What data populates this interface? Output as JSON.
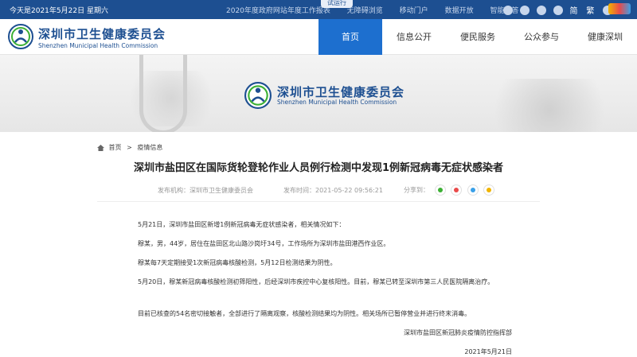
{
  "topbar": {
    "date": "今天是2021年5月22日 星期六",
    "links": [
      "2020年度政府网站年度工作报表",
      "无障碍浏览",
      "移动门户",
      "数据开放",
      "智能问答"
    ],
    "trial_badge": "试运行",
    "lang_simplified": "简",
    "lang_traditional": "繁",
    "icons": [
      "microphone-icon",
      "weibo-icon",
      "wechat-icon",
      "person-icon"
    ]
  },
  "header": {
    "site_name": "深圳市卫生健康委员会",
    "site_name_en": "Shenzhen Municipal Health Commission",
    "nav": [
      "首页",
      "信息公开",
      "便民服务",
      "公众参与",
      "健康深圳"
    ],
    "active_nav": "首页"
  },
  "banner": {
    "site_name": "深圳市卫生健康委员会",
    "site_name_en": "Shenzhen Municipal Health Commission"
  },
  "breadcrumb": {
    "home": "首页",
    "current": "疫情信息"
  },
  "article": {
    "title": "深圳市盐田区在国际货轮登轮作业人员例行检测中发现1例新冠病毒无症状感染者",
    "publisher": "发布机构：深圳市卫生健康委员会",
    "publish_time": "发布时间：2021-05-22 09:56:21",
    "share_label": "分享到：",
    "share_colors": [
      "#3cb034",
      "#e94a4a",
      "#3aa0e8",
      "#f0b400"
    ],
    "paragraphs": [
      "5月21日，深圳市盐田区新增1例新冠病毒无症状感染者，相关情况如下：",
      "穆某，男，44岁，居住在盐田区北山路沙岗圩34号，工作场所为深圳市盐田港西作业区。",
      "穆某每7天定期接受1次新冠病毒核酸检测，5月12日检测结果为阴性。",
      "5月20日，穆某新冠病毒核酸检测初筛阳性，后经深圳市疾控中心复核阳性。目前，穆某已转至深圳市第三人民医院隔离治疗。",
      "目前已核查的54名密切接触者，全部进行了隔离观察，核酸检测结果均为阴性。相关场所已暂停营业并进行终末消毒。"
    ],
    "signature": "深圳市盐田区新冠肺炎疫情防控指挥部",
    "date": "2021年5月21日"
  },
  "colors": {
    "topbar": "#1d4f91",
    "nav_active": "#1d6fcf",
    "brand": "#1d4f91"
  }
}
